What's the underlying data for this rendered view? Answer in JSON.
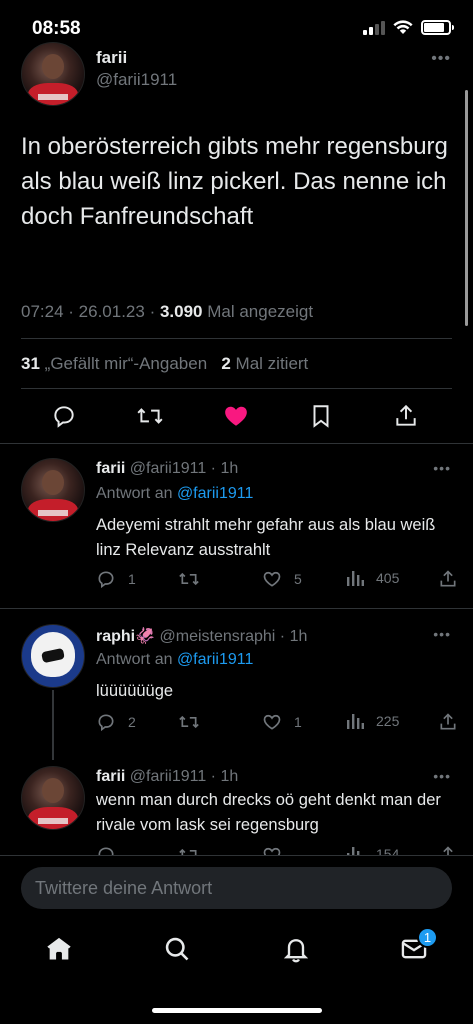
{
  "status_bar": {
    "time": "08:58"
  },
  "main_tweet": {
    "name": "farii",
    "handle": "@farii1911",
    "more": "•••",
    "text": "In oberösterreich gibts mehr regensburg als blau weiß linz pickerl. Das nenne ich doch Fanfreundschaft",
    "time": "07:24",
    "date": "26.01.23",
    "views": "3.090",
    "views_label": "Mal angezeigt",
    "likes_count": "31",
    "likes_label": "„Gefällt mir“-Angaben",
    "quotes_count": "2",
    "quotes_label": "Mal zitiert",
    "liked": true,
    "accent_like": "#f91880"
  },
  "replies": [
    {
      "name": "farii",
      "handle": "@farii1911",
      "age": "1h",
      "reply_to_label": "Antwort an",
      "reply_to": "@farii1911",
      "text": "Adeyemi strahlt mehr gefahr aus als blau weiß linz Relevanz ausstrahlt",
      "replies": "1",
      "retweets": "",
      "likes": "5",
      "views": "405"
    },
    {
      "name": "raphi🦑",
      "handle": "@meistensraphi",
      "age": "1h",
      "reply_to_label": "Antwort an",
      "reply_to": "@farii1911",
      "text": "lüüüüüüge",
      "replies": "2",
      "retweets": "",
      "likes": "1",
      "views": "225"
    },
    {
      "name": "farii",
      "handle": "@farii1911",
      "age": "1h",
      "text": "wenn man durch drecks oö geht denkt man der rivale vom lask sei regensburg",
      "views": "154"
    }
  ],
  "reply_input": {
    "placeholder": "Twittere deine Antwort"
  },
  "bottom_nav": {
    "items": [
      "home-icon",
      "search-icon",
      "notifications-icon",
      "messages-icon"
    ],
    "messages_badge": "1"
  },
  "colors": {
    "background": "#000000",
    "link": "#1d9bf0",
    "muted": "#71767b"
  }
}
